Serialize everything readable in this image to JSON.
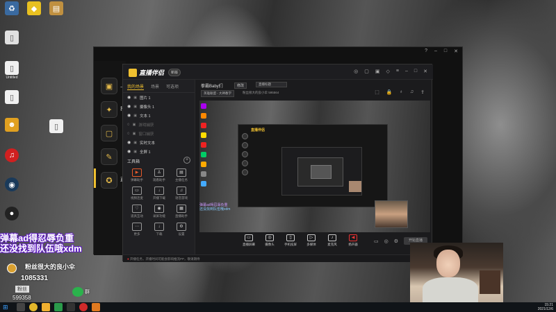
{
  "desktop": {
    "icons": [
      {
        "name": "recycle-bin",
        "label": ""
      },
      {
        "name": "yellow-app",
        "label": ""
      },
      {
        "name": "folder",
        "label": ""
      },
      {
        "name": "file-1",
        "label": "Untitled"
      },
      {
        "name": "file-2",
        "label": ""
      },
      {
        "name": "app-bee",
        "label": ""
      },
      {
        "name": "netease-music",
        "label": ""
      },
      {
        "name": "steam",
        "label": ""
      },
      {
        "name": "obs",
        "label": ""
      }
    ],
    "desktop_file_label": ""
  },
  "outer_window": {
    "title": "直播",
    "controls": [
      "?",
      "–",
      "□",
      "✕"
    ],
    "side_items": [
      {
        "label": "上"
      },
      {
        "label": "打"
      },
      {
        "label": ""
      },
      {
        "label": ""
      },
      {
        "label": "直"
      }
    ]
  },
  "app": {
    "brand": "直播伴侣",
    "version": "新版",
    "header_icons": [
      "◎",
      "▢",
      "▣",
      "◇",
      "≡",
      "–",
      "□",
      "✕"
    ],
    "left_tabs": [
      {
        "label": "我的场景",
        "active": true
      },
      {
        "label": "场景",
        "active": false
      },
      {
        "label": "可选项",
        "active": false
      }
    ],
    "scenes": [
      {
        "label": "图片 1",
        "visible": true
      },
      {
        "label": "摄像头 1",
        "visible": true
      },
      {
        "label": "文本 1",
        "visible": true
      },
      {
        "label": "游戏捕获",
        "visible": false
      },
      {
        "label": "窗口捕获",
        "visible": false
      },
      {
        "label": "实时文本",
        "visible": true
      },
      {
        "label": "全屏 1",
        "visible": true
      }
    ],
    "tools_title": "工具箱",
    "tools": [
      {
        "label": "弹幕助手",
        "icon": "▶",
        "hot": true
      },
      {
        "label": "观看助手",
        "icon": "♙",
        "hot": false
      },
      {
        "label": "主播任务",
        "icon": "▤",
        "hot": false
      },
      {
        "label": "视频连麦",
        "icon": "▭",
        "hot": false
      },
      {
        "label": "开播下载",
        "icon": "↓",
        "hot": false
      },
      {
        "label": "语音游戏",
        "icon": "♫",
        "hot": false
      },
      {
        "label": "道具互动",
        "icon": "♡",
        "hot": false
      },
      {
        "label": "录屏功能",
        "icon": "◉",
        "hot": false
      },
      {
        "label": "直播助手",
        "icon": "▦",
        "hot": false
      },
      {
        "label": "更多",
        "icon": "⋯",
        "hot": false
      },
      {
        "label": "下载",
        "icon": "↓",
        "hot": false
      },
      {
        "label": "设置",
        "icon": "⚙",
        "hot": false
      }
    ],
    "status_text": "开播任务，开播时间可能会影响推流PP，敬请期待",
    "room": {
      "name": "拳霸Baby们",
      "tag": "修改",
      "edit_placeholder": "直播标题",
      "category": "英雄联盟 - 大神教学",
      "meta": "粉丝很大的良小伞  595564",
      "likes": "52"
    },
    "room_icons": [
      "⬚",
      "🔒",
      "♁",
      "♫",
      "⇪"
    ],
    "bottom_items": [
      {
        "label": "直播屏幕",
        "icon": "▭"
      },
      {
        "label": "摄像头",
        "icon": "◎"
      },
      {
        "label": "手机投屏",
        "icon": "▯"
      },
      {
        "label": "多媒体",
        "icon": "▷"
      },
      {
        "label": "麦克风",
        "icon": "♪"
      },
      {
        "label": "扬声器",
        "icon": "◀"
      }
    ],
    "bottom_right_icons": [
      "▭",
      "◎",
      "⚙"
    ],
    "live_button": "开始直播",
    "nested_brand": "直播伴侣"
  },
  "overlay": {
    "line1": "弹幕ad得忍辱负重",
    "line2": "还没找到队伍哦xdm",
    "user": "粉丝很大的良小伞",
    "num1": "1085331",
    "badge": "粉丝",
    "num2": "599358",
    "wechat_caption": "群"
  },
  "taskbar": {
    "start": "⊞",
    "icons": [
      {
        "name": "search",
        "color": "#444444"
      },
      {
        "name": "chrome",
        "color": "#e2b72b"
      },
      {
        "name": "explorer",
        "color": "#f0b030"
      },
      {
        "name": "app-green",
        "color": "#2a9a4a"
      },
      {
        "name": "app-dark",
        "color": "#333333"
      },
      {
        "name": "app-red",
        "color": "#d02a2a"
      },
      {
        "name": "app-orange",
        "color": "#e07a20"
      }
    ],
    "time": "15:21",
    "date": "2021/12/6"
  }
}
